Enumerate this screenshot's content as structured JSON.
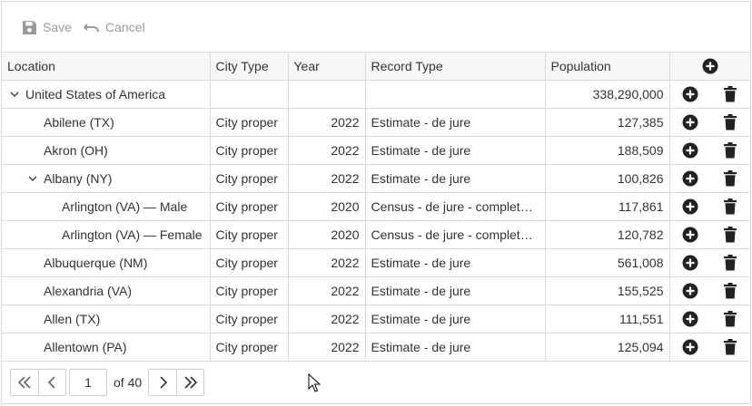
{
  "toolbar": {
    "save_label": "Save",
    "cancel_label": "Cancel"
  },
  "columns": {
    "location": "Location",
    "city_type": "City Type",
    "year": "Year",
    "record_type": "Record Type",
    "population": "Population"
  },
  "rows": [
    {
      "location": "United States of America",
      "city_type": "",
      "year": "",
      "record_type": "",
      "population": "338,290,000"
    },
    {
      "location": "Abilene (TX)",
      "city_type": "City proper",
      "year": "2022",
      "record_type": "Estimate - de jure",
      "population": "127,385"
    },
    {
      "location": "Akron (OH)",
      "city_type": "City proper",
      "year": "2022",
      "record_type": "Estimate - de jure",
      "population": "188,509"
    },
    {
      "location": "Albany (NY)",
      "city_type": "City proper",
      "year": "2022",
      "record_type": "Estimate - de jure",
      "population": "100,826"
    },
    {
      "location": "Arlington (VA) — Male",
      "city_type": "City proper",
      "year": "2020",
      "record_type": "Census - de jure - complete…",
      "population": "117,861"
    },
    {
      "location": "Arlington (VA) — Female",
      "city_type": "City proper",
      "year": "2020",
      "record_type": "Census - de jure - complete…",
      "population": "120,782"
    },
    {
      "location": "Albuquerque (NM)",
      "city_type": "City proper",
      "year": "2022",
      "record_type": "Estimate - de jure",
      "population": "561,008"
    },
    {
      "location": "Alexandria (VA)",
      "city_type": "City proper",
      "year": "2022",
      "record_type": "Estimate - de jure",
      "population": "155,525"
    },
    {
      "location": "Allen (TX)",
      "city_type": "City proper",
      "year": "2022",
      "record_type": "Estimate - de jure",
      "population": "111,551"
    },
    {
      "location": "Allentown (PA)",
      "city_type": "City proper",
      "year": "2022",
      "record_type": "Estimate - de jure",
      "population": "125,094"
    }
  ],
  "pager": {
    "current_page": "1",
    "of_label": "of 40"
  },
  "icons": {
    "save": "save-icon",
    "cancel": "undo-icon",
    "add": "plus-circle-icon",
    "delete": "trash-icon",
    "expand": "chevron-down-icon",
    "first": "double-chevron-left-icon",
    "prev": "chevron-left-icon",
    "next": "chevron-right-icon",
    "last": "double-chevron-right-icon"
  },
  "colors": {
    "disabled_text": "#9a9a9a",
    "icon_dark": "#222222",
    "border": "#dadada",
    "header_bg": "#f7f7f7"
  }
}
